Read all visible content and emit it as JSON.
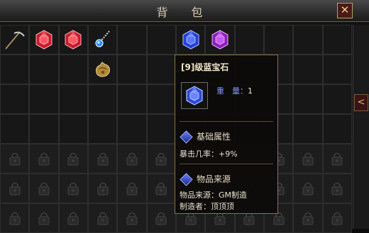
{
  "window": {
    "title": "背 包",
    "close_label": "✕"
  },
  "side_panel": {
    "arrow_label": "<"
  },
  "grid": {
    "rows": 7,
    "cols": 12,
    "items": [
      {
        "row": 0,
        "col": 0,
        "icon": "pickaxe-icon"
      },
      {
        "row": 0,
        "col": 1,
        "icon": "red-gem-icon"
      },
      {
        "row": 0,
        "col": 2,
        "icon": "red-gem-icon"
      },
      {
        "row": 0,
        "col": 3,
        "icon": "necklace-icon"
      },
      {
        "row": 0,
        "col": 6,
        "icon": "blue-gem-icon"
      },
      {
        "row": 0,
        "col": 7,
        "icon": "purple-gem-icon"
      },
      {
        "row": 1,
        "col": 3,
        "icon": "golden-pouch-icon"
      }
    ],
    "locked_from_row": 4
  },
  "tooltip": {
    "title": "[9]级蓝宝石",
    "weight_label": "重　量：",
    "weight_value": "1",
    "section1_title": "基础属性",
    "crit_line": "暴击几率：+9%",
    "section2_title": "物品来源",
    "source_line": "物品来源：GM制造",
    "maker_line": "制造者：顶顶顶"
  },
  "colors": {
    "gem_red": "#e2333f",
    "gem_blue": "#3a58f0",
    "gem_purple": "#b23ad6",
    "frame_gold": "#8a7248"
  }
}
